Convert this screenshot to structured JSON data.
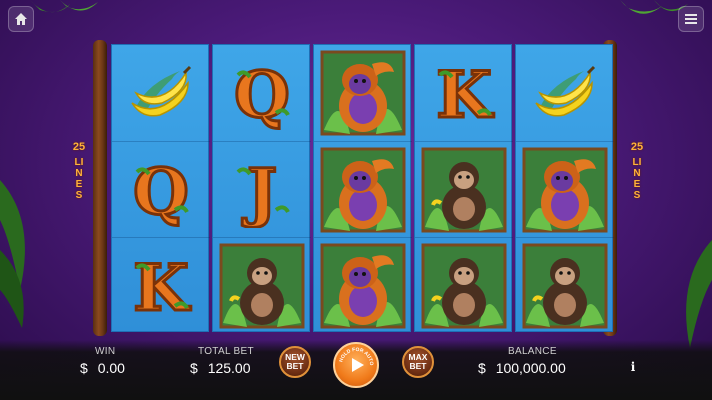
{
  "top": {
    "home_icon": "home-icon",
    "menu_icon": "menu-icon"
  },
  "paylines": {
    "count": "25",
    "label": "LINES"
  },
  "reels": [
    [
      "banana",
      "Q",
      "K"
    ],
    [
      "Q",
      "J",
      "chimp"
    ],
    [
      "orangutan",
      "orangutan",
      "orangutan"
    ],
    [
      "K",
      "chimp",
      "chimp"
    ],
    [
      "banana",
      "orangutan",
      "chimp"
    ]
  ],
  "bottom": {
    "win_label": "WIN",
    "currency": "$",
    "win_value": "0.00",
    "total_bet_label": "TOTAL BET",
    "total_bet_value": "125.00",
    "new_bet_label": "NEW BET",
    "spin_hint": "HOLD FOR AUTOSPIN",
    "max_bet_label": "MAX BET",
    "balance_label": "BALANCE",
    "balance_value": "100,000.00",
    "info_label": "i"
  },
  "colors": {
    "background": "#4a1a78",
    "reel_blue": "#3fa6e8",
    "accent_orange": "#f07a1a",
    "lines_text": "#ffb23a"
  }
}
